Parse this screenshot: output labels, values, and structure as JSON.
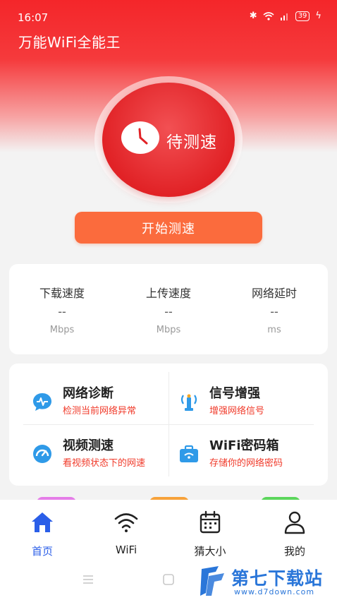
{
  "status": {
    "time": "16:07",
    "battery": "39"
  },
  "app": {
    "title": "万能WiFi全能王"
  },
  "dial": {
    "label": "待测速"
  },
  "start_button": {
    "label": "开始测速"
  },
  "speed_stats": [
    {
      "title": "下载速度",
      "value": "--",
      "unit": "Mbps"
    },
    {
      "title": "上传速度",
      "value": "--",
      "unit": "Mbps"
    },
    {
      "title": "网络延时",
      "value": "--",
      "unit": "ms"
    }
  ],
  "tools": [
    {
      "title": "网络诊断",
      "desc": "检测当前网络异常",
      "icon": "chat-pulse-icon"
    },
    {
      "title": "信号增强",
      "desc": "增强网络信号",
      "icon": "signal-tower-icon"
    },
    {
      "title": "视频测速",
      "desc": "看视频状态下的网速",
      "icon": "speedometer-icon"
    },
    {
      "title": "WiFi密码箱",
      "desc": "存储你的网络密码",
      "icon": "toolbox-icon"
    }
  ],
  "tabs": [
    {
      "label": "首页",
      "icon": "home-icon",
      "active": true
    },
    {
      "label": "WiFi",
      "icon": "wifi-icon",
      "active": false
    },
    {
      "label": "猜大小",
      "icon": "calendar-icon",
      "active": false
    },
    {
      "label": "我的",
      "icon": "user-icon",
      "active": false
    }
  ],
  "watermark": {
    "title": "第七下载站",
    "url": "www.d7down.com"
  },
  "colors": {
    "brand_red": "#e12226",
    "accent_orange": "#fb6b3d",
    "tab_active": "#2a5ee8",
    "desc_red": "#f03a2a"
  }
}
